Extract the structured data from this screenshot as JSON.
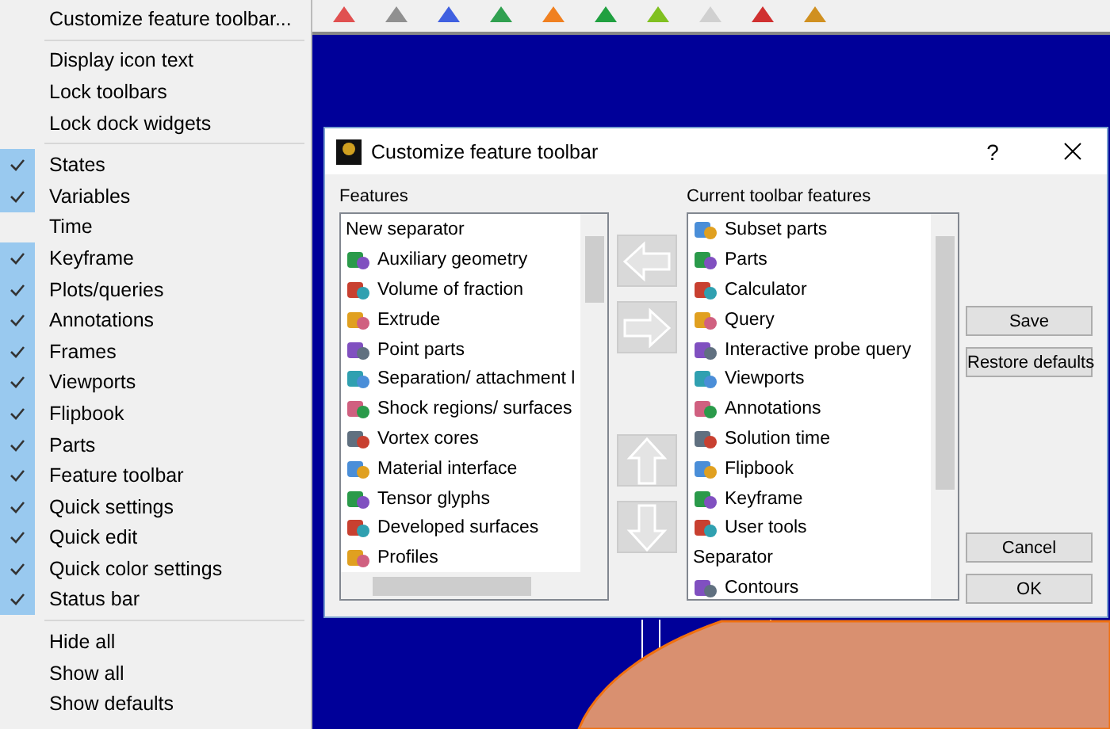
{
  "menu": {
    "sections": [
      {
        "items": [
          {
            "label": "Customize feature toolbar..."
          }
        ]
      },
      {
        "items": [
          {
            "label": "Display icon text"
          },
          {
            "label": "Lock toolbars"
          },
          {
            "label": "Lock dock widgets"
          }
        ]
      },
      {
        "items": [
          {
            "label": "States",
            "checked": true
          },
          {
            "label": "Variables",
            "checked": true
          },
          {
            "label": "Time",
            "checked": false
          },
          {
            "label": "Keyframe",
            "checked": true
          },
          {
            "label": "Plots/queries",
            "checked": true
          },
          {
            "label": "Annotations",
            "checked": true
          },
          {
            "label": "Frames",
            "checked": true
          },
          {
            "label": "Viewports",
            "checked": true
          },
          {
            "label": "Flipbook",
            "checked": true
          },
          {
            "label": "Parts",
            "checked": true
          },
          {
            "label": "Feature toolbar",
            "checked": true
          },
          {
            "label": "Quick settings",
            "checked": true
          },
          {
            "label": "Quick edit",
            "checked": true
          },
          {
            "label": "Quick color settings",
            "checked": true
          },
          {
            "label": "Status bar",
            "checked": true
          }
        ]
      },
      {
        "items": [
          {
            "label": "Hide all"
          },
          {
            "label": "Show all"
          },
          {
            "label": "Show defaults"
          }
        ]
      }
    ]
  },
  "dialog": {
    "title": "Customize feature toolbar",
    "help": "?",
    "features": {
      "label": "Features",
      "items": [
        {
          "label": "New separator",
          "kind": "plain"
        },
        {
          "label": "Auxiliary geometry",
          "kind": "icon"
        },
        {
          "label": "Volume of fraction",
          "kind": "icon"
        },
        {
          "label": "Extrude",
          "kind": "icon"
        },
        {
          "label": "Point parts",
          "kind": "icon"
        },
        {
          "label": "Separation/ attachment l",
          "kind": "icon"
        },
        {
          "label": "Shock regions/ surfaces",
          "kind": "icon"
        },
        {
          "label": "Vortex cores",
          "kind": "icon"
        },
        {
          "label": "Material interface",
          "kind": "icon"
        },
        {
          "label": "Tensor glyphs",
          "kind": "icon"
        },
        {
          "label": "Developed surfaces",
          "kind": "icon"
        },
        {
          "label": "Profiles",
          "kind": "icon"
        }
      ]
    },
    "current": {
      "label": "Current toolbar features",
      "items": [
        {
          "label": "Subset parts",
          "kind": "icon"
        },
        {
          "label": "Parts",
          "kind": "icon"
        },
        {
          "label": "Calculator",
          "kind": "icon"
        },
        {
          "label": "Query",
          "kind": "icon"
        },
        {
          "label": "Interactive probe query",
          "kind": "icon"
        },
        {
          "label": "Viewports",
          "kind": "icon"
        },
        {
          "label": "Annotations",
          "kind": "icon"
        },
        {
          "label": "Solution time",
          "kind": "icon"
        },
        {
          "label": "Flipbook",
          "kind": "icon"
        },
        {
          "label": "Keyframe",
          "kind": "icon"
        },
        {
          "label": "User tools",
          "kind": "icon"
        },
        {
          "label": "Separator",
          "kind": "plain"
        },
        {
          "label": "Contours",
          "kind": "icon"
        }
      ]
    },
    "buttons_top": [
      "Save",
      "Restore defaults"
    ],
    "buttons_bottom": [
      "Cancel",
      "OK"
    ]
  }
}
